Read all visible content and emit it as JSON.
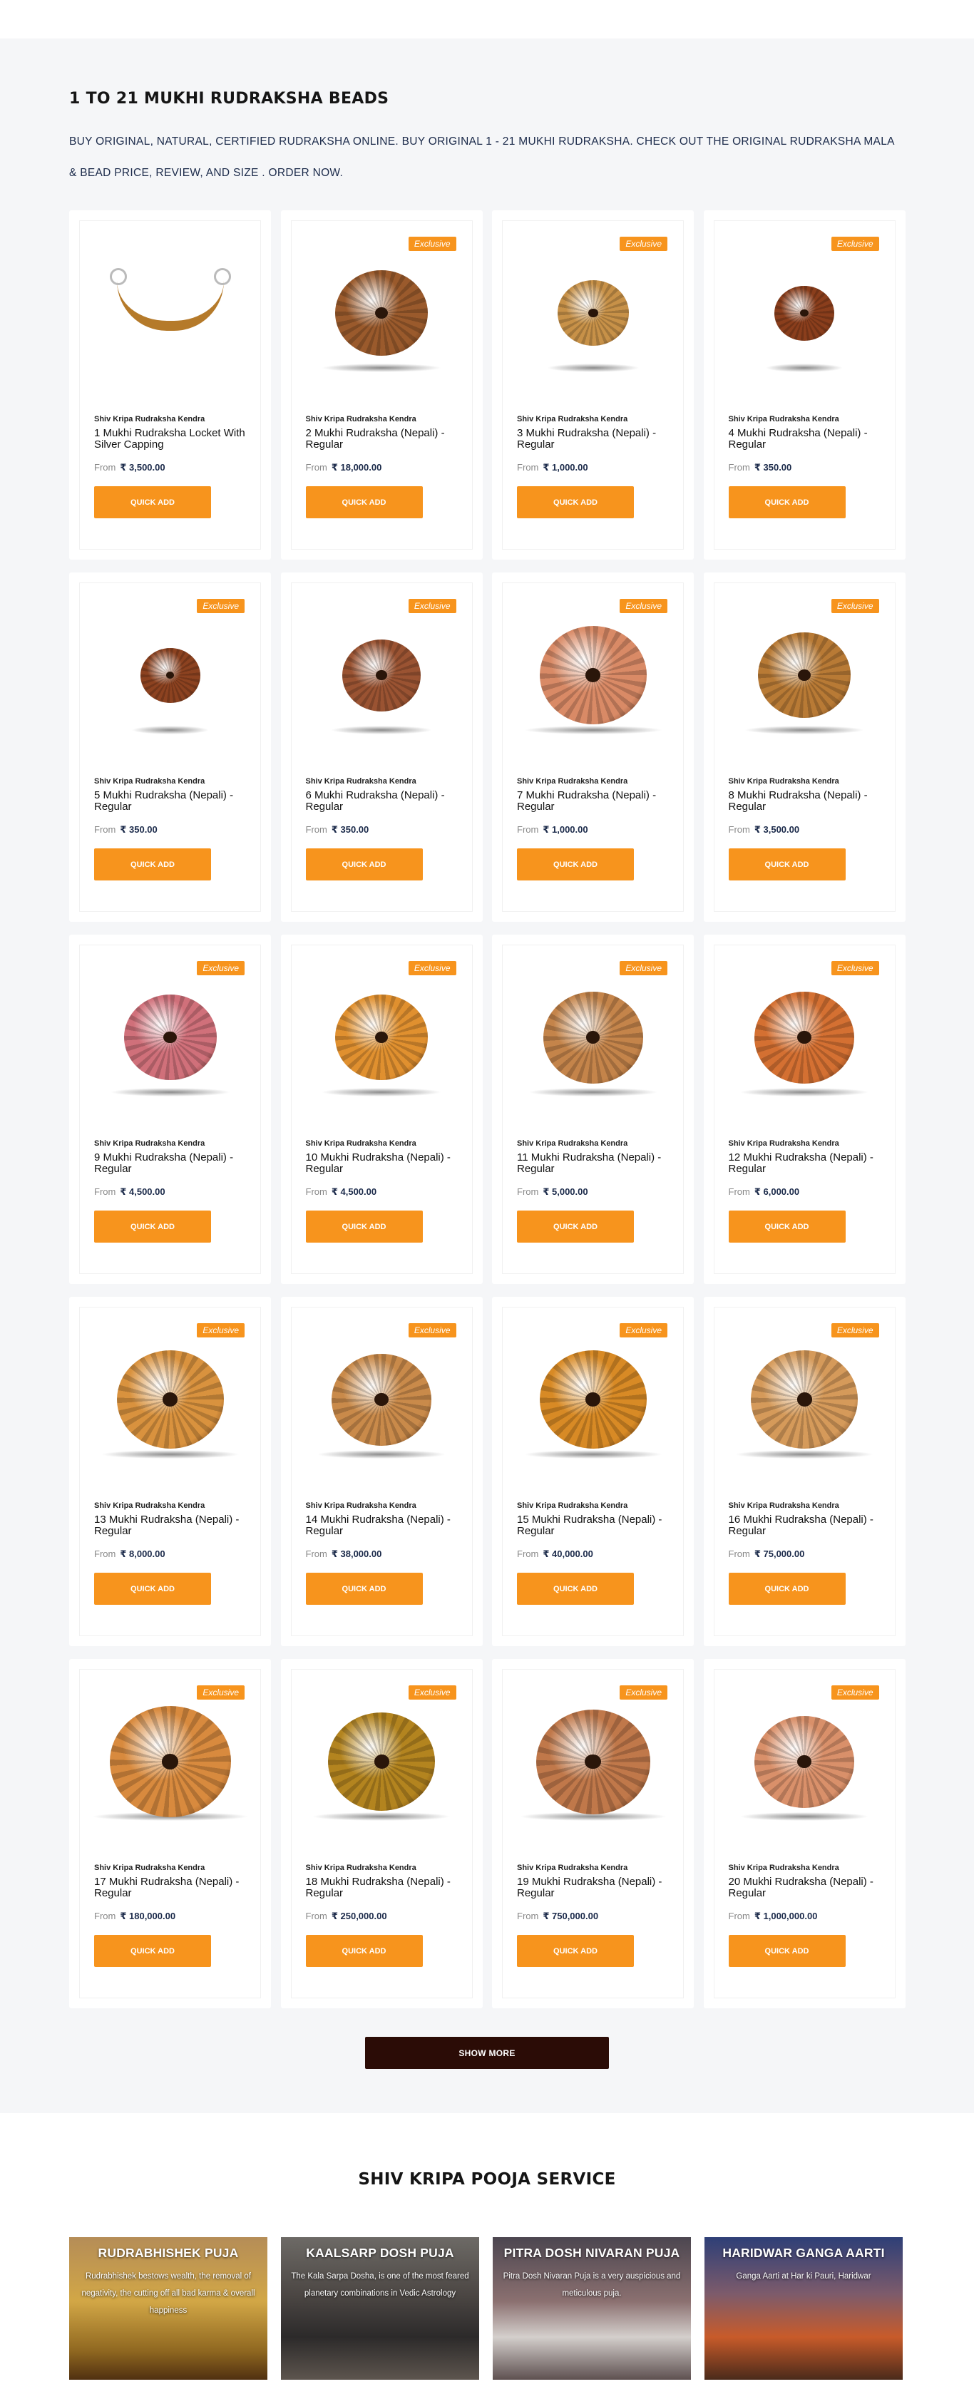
{
  "products_section": {
    "title": "1 TO 21 MUKHI RUDRAKSHA BEADS",
    "description": "BUY ORIGINAL, NATURAL, CERTIFIED RUDRAKSHA ONLINE. BUY ORIGINAL 1 - 21 MUKHI RUDRAKSHA. CHECK OUT THE ORIGINAL RUDRAKSHA MALA & BEAD PRICE, REVIEW, AND SIZE . ORDER NOW.",
    "from_label": "From",
    "quick_add_label": "QUICK ADD",
    "badge_label": "Exclusive",
    "products": [
      {
        "vendor": "Shiv Kripa Rudraksha Kendra",
        "name": "1 Mukhi Rudraksha Locket With Silver Capping",
        "price": "₹ 3,500.00",
        "badge": false,
        "color": "#b57a2a"
      },
      {
        "vendor": "Shiv Kripa Rudraksha Kendra",
        "name": "2 Mukhi Rudraksha (Nepali) - Regular",
        "price": "₹ 18,000.00",
        "badge": true,
        "color": "#9a5a2c"
      },
      {
        "vendor": "Shiv Kripa Rudraksha Kendra",
        "name": "3 Mukhi Rudraksha (Nepali) - Regular",
        "price": "₹ 1,000.00",
        "badge": true,
        "color": "#c79148"
      },
      {
        "vendor": "Shiv Kripa Rudraksha Kendra",
        "name": "4 Mukhi Rudraksha (Nepali) - Regular",
        "price": "₹ 350.00",
        "badge": true,
        "color": "#8a3e1c"
      },
      {
        "vendor": "Shiv Kripa Rudraksha Kendra",
        "name": "5 Mukhi Rudraksha (Nepali) - Regular",
        "price": "₹ 350.00",
        "badge": true,
        "color": "#8c4220"
      },
      {
        "vendor": "Shiv Kripa Rudraksha Kendra",
        "name": "6 Mukhi Rudraksha (Nepali) - Regular",
        "price": "₹ 350.00",
        "badge": true,
        "color": "#9a5332"
      },
      {
        "vendor": "Shiv Kripa Rudraksha Kendra",
        "name": "7 Mukhi Rudraksha (Nepali) - Regular",
        "price": "₹ 1,000.00",
        "badge": true,
        "color": "#d98a66"
      },
      {
        "vendor": "Shiv Kripa Rudraksha Kendra",
        "name": "8 Mukhi Rudraksha (Nepali) - Regular",
        "price": "₹ 3,500.00",
        "badge": true,
        "color": "#b87a35"
      },
      {
        "vendor": "Shiv Kripa Rudraksha Kendra",
        "name": "9 Mukhi Rudraksha (Nepali) - Regular",
        "price": "₹ 4,500.00",
        "badge": true,
        "color": "#d0707a"
      },
      {
        "vendor": "Shiv Kripa Rudraksha Kendra",
        "name": "10 Mukhi Rudraksha (Nepali) - Regular",
        "price": "₹ 4,500.00",
        "badge": true,
        "color": "#e0902f"
      },
      {
        "vendor": "Shiv Kripa Rudraksha Kendra",
        "name": "11 Mukhi Rudraksha (Nepali) - Regular",
        "price": "₹ 5,000.00",
        "badge": true,
        "color": "#c4844a"
      },
      {
        "vendor": "Shiv Kripa Rudraksha Kendra",
        "name": "12 Mukhi Rudraksha (Nepali) - Regular",
        "price": "₹ 6,000.00",
        "badge": true,
        "color": "#d47032"
      },
      {
        "vendor": "Shiv Kripa Rudraksha Kendra",
        "name": "13 Mukhi Rudraksha (Nepali) - Regular",
        "price": "₹ 8,000.00",
        "badge": true,
        "color": "#d9923e"
      },
      {
        "vendor": "Shiv Kripa Rudraksha Kendra",
        "name": "14 Mukhi Rudraksha (Nepali) - Regular",
        "price": "₹ 38,000.00",
        "badge": true,
        "color": "#c98a4a"
      },
      {
        "vendor": "Shiv Kripa Rudraksha Kendra",
        "name": "15 Mukhi Rudraksha (Nepali) - Regular",
        "price": "₹ 40,000.00",
        "badge": true,
        "color": "#d88a25"
      },
      {
        "vendor": "Shiv Kripa Rudraksha Kendra",
        "name": "16 Mukhi Rudraksha (Nepali) - Regular",
        "price": "₹ 75,000.00",
        "badge": true,
        "color": "#d59a5a"
      },
      {
        "vendor": "Shiv Kripa Rudraksha Kendra",
        "name": "17 Mukhi Rudraksha (Nepali) - Regular",
        "price": "₹ 180,000.00",
        "badge": true,
        "color": "#d88a3e"
      },
      {
        "vendor": "Shiv Kripa Rudraksha Kendra",
        "name": "18 Mukhi Rudraksha (Nepali) - Regular",
        "price": "₹ 250,000.00",
        "badge": true,
        "color": "#b3841f"
      },
      {
        "vendor": "Shiv Kripa Rudraksha Kendra",
        "name": "19 Mukhi Rudraksha (Nepali) - Regular",
        "price": "₹ 750,000.00",
        "badge": true,
        "color": "#c0784a"
      },
      {
        "vendor": "Shiv Kripa Rudraksha Kendra",
        "name": "20 Mukhi Rudraksha (Nepali) - Regular",
        "price": "₹ 1,000,000.00",
        "badge": true,
        "color": "#d9906a"
      }
    ],
    "show_more_label": "SHOW MORE"
  },
  "pooja_section": {
    "title": "SHIV KRIPA POOJA SERVICE",
    "services": [
      {
        "title": "RUDRABHISHEK PUJA",
        "text": "Rudrabhishek bestows wealth, the removal of negativity, the cutting off all bad karma & overall happiness"
      },
      {
        "title": "KAALSARP DOSH PUJA",
        "text": "The Kala Sarpa Dosha, is one of the most feared planetary combinations in Vedic Astrology"
      },
      {
        "title": "PITRA DOSH NIVARAN PUJA",
        "text": "Pitra Dosh Nivaran Puja is a very auspicious and meticulous puja."
      },
      {
        "title": "HARIDWAR GANGA AARTI",
        "text": "Ganga Aarti at Har ki Pauri, Haridwar"
      }
    ]
  }
}
